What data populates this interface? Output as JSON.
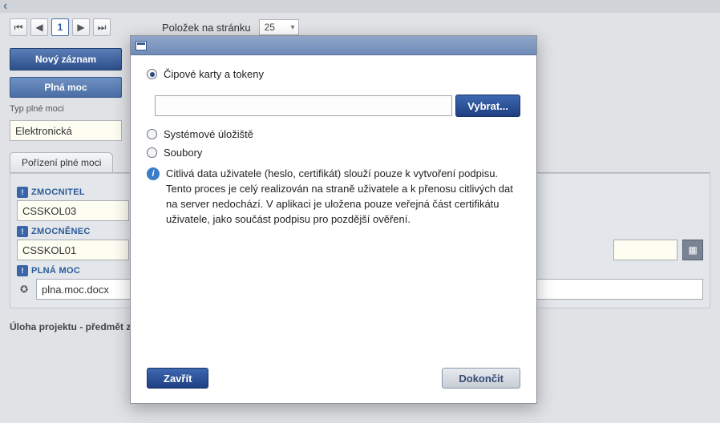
{
  "topbar": {
    "back_glyph": "‹"
  },
  "pager": {
    "first_glyph": "⏮",
    "prev_glyph": "◀",
    "page": "1",
    "next_glyph": "▶",
    "last_glyph": "⏭",
    "label": "Položek na stránku",
    "per_page": "25",
    "dropdown_glyph": "▾"
  },
  "buttons": {
    "novy": "Nový záznam",
    "plna_moc": "Plná moc"
  },
  "labels": {
    "typ_plne_moci": "Typ plné moci",
    "typ_value": "Elektronická",
    "tab_porizeni": "Pořízení plné moci"
  },
  "form": {
    "zmocnitel_label": "ZMOCNITEL",
    "zmocnitel_value": "CSSKOL03",
    "zmocnenec_label": "ZMOCNĚNEC",
    "zmocnenec_value": "CSSKOL01",
    "plna_moc_label": "PLNÁ MOC",
    "plna_moc_value": "plna.moc.docx",
    "badge_glyph": "!",
    "ribbon_glyph": "✪",
    "cal_glyph": "▦"
  },
  "footer": {
    "text": "Úloha projektu - předmět zmocnění"
  },
  "modal": {
    "radio_cip": "Čipové karty a tokeny",
    "radio_sys": "Systémové úložiště",
    "radio_soubory": "Soubory",
    "vybrat": "Vybrat...",
    "info_glyph": "i",
    "info_text": "Citlivá data uživatele (heslo, certifikát) slouží pouze k vytvoření podpisu. Tento proces je celý realizován na straně uživatele a k přenosu citlivých dat na server nedochází. V aplikaci je uložena pouze veřejná část certifikátu uživatele, jako součást podpisu pro pozdější ověření.",
    "zavrit": "Zavřít",
    "dokoncit": "Dokončit"
  }
}
